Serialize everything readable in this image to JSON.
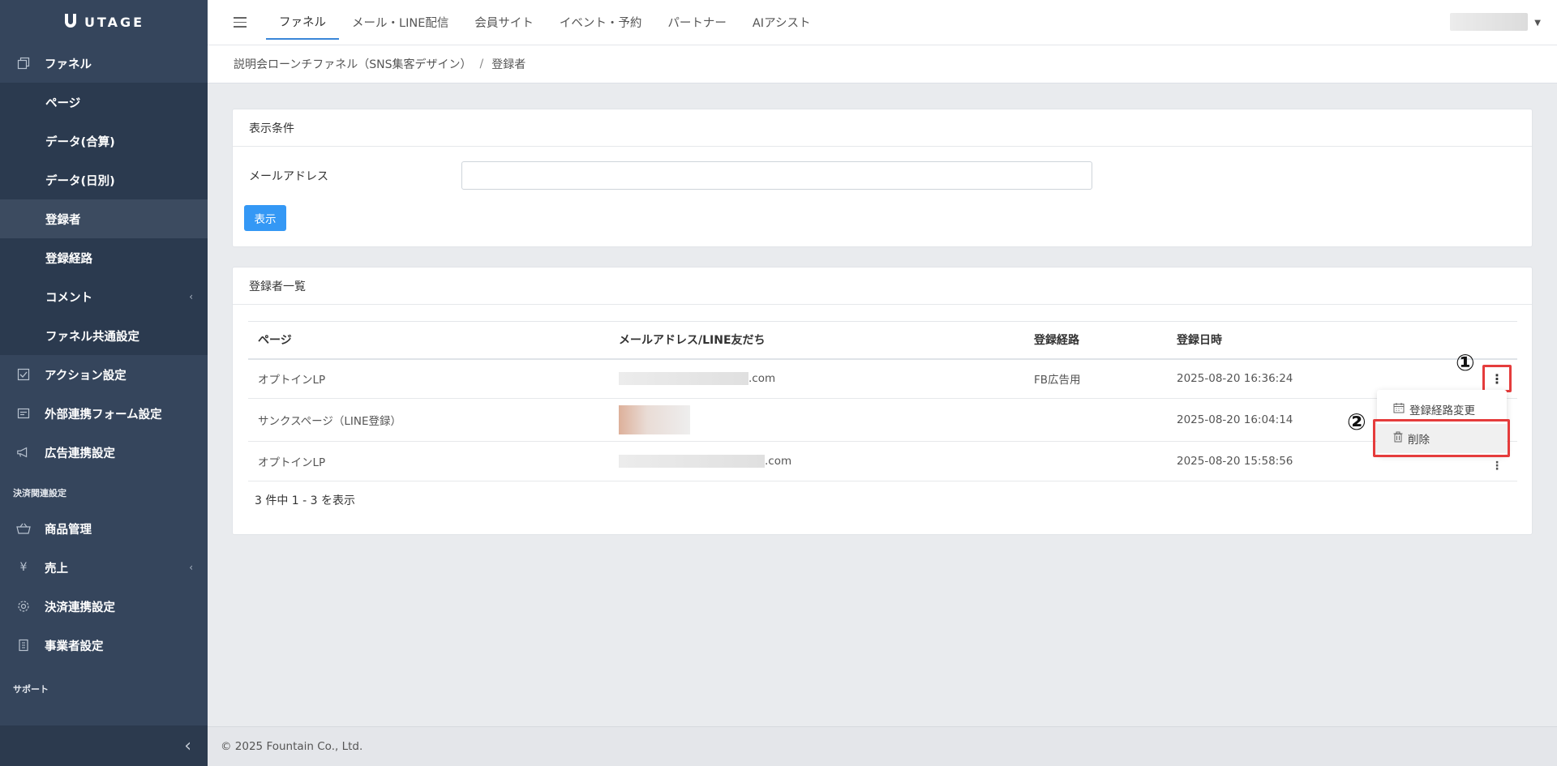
{
  "brand": {
    "name": "UTAGE"
  },
  "sidebar": {
    "funnel": {
      "label": "ファネル",
      "icon": "copy-icon"
    },
    "sub_items": [
      {
        "label": "ページ"
      },
      {
        "label": "データ(合算)"
      },
      {
        "label": "データ(日別)"
      },
      {
        "label": "登録者"
      },
      {
        "label": "登録経路"
      },
      {
        "label": "コメント"
      },
      {
        "label": "ファネル共通設定"
      }
    ],
    "comment_chevron": "‹",
    "items": [
      {
        "label": "アクション設定",
        "icon": "check-square-icon"
      },
      {
        "label": "外部連携フォーム設定",
        "icon": "form-icon"
      },
      {
        "label": "広告連携設定",
        "icon": "megaphone-icon"
      }
    ],
    "section_payment": "決済関連設定",
    "payment_items": [
      {
        "label": "商品管理",
        "icon": "basket-icon"
      },
      {
        "label": "売上",
        "icon": "yen-icon",
        "symbol": "¥"
      },
      {
        "label": "決済連携設定",
        "icon": "gear-icon"
      },
      {
        "label": "事業者設定",
        "icon": "building-icon"
      }
    ],
    "sales_chevron": "‹",
    "section_support": "サポート",
    "collapse_icon": "‹"
  },
  "topbar": {
    "tabs": [
      {
        "label": "ファネル",
        "active": true
      },
      {
        "label": "メール・LINE配信"
      },
      {
        "label": "会員サイト"
      },
      {
        "label": "イベント・予約"
      },
      {
        "label": "パートナー"
      },
      {
        "label": "AIアシスト"
      }
    ],
    "user_caret": "▼"
  },
  "breadcrumb": {
    "parent": "説明会ローンチファネル（SNS集客デザイン）",
    "separator": "/",
    "current": "登録者"
  },
  "filter_card": {
    "title": "表示条件",
    "email_label": "メールアドレス",
    "email_value": "",
    "show_button": "表示"
  },
  "list_card": {
    "title": "登録者一覧",
    "columns": [
      "ページ",
      "メールアドレス/LINE友だち",
      "登録経路",
      "登録日時"
    ],
    "rows": [
      {
        "page": "オプトインLP",
        "email_suffix": ".com",
        "route": "FB広告用",
        "datetime": "2025-08-20 16:36:24"
      },
      {
        "page": "サンクスページ（LINE登録）",
        "email_suffix": "",
        "route": "",
        "datetime": "2025-08-20 16:04:14"
      },
      {
        "page": "オプトインLP",
        "email_suffix": ".com",
        "route": "",
        "datetime": "2025-08-20 15:58:56"
      }
    ],
    "summary": "3 件中 1 - 3 を表示"
  },
  "dropdown": {
    "items": [
      {
        "label": "登録経路変更",
        "icon": "calendar-icon"
      },
      {
        "label": "削除",
        "icon": "trash-icon"
      }
    ]
  },
  "annotations": {
    "one": "①",
    "two": "②"
  },
  "kebab_symbol": "⋮",
  "footer": {
    "text": "© 2025 Fountain Co., Ltd."
  },
  "colors": {
    "sidebar": "#35455c",
    "accent": "#3498f5",
    "highlight": "#e53c3c"
  }
}
